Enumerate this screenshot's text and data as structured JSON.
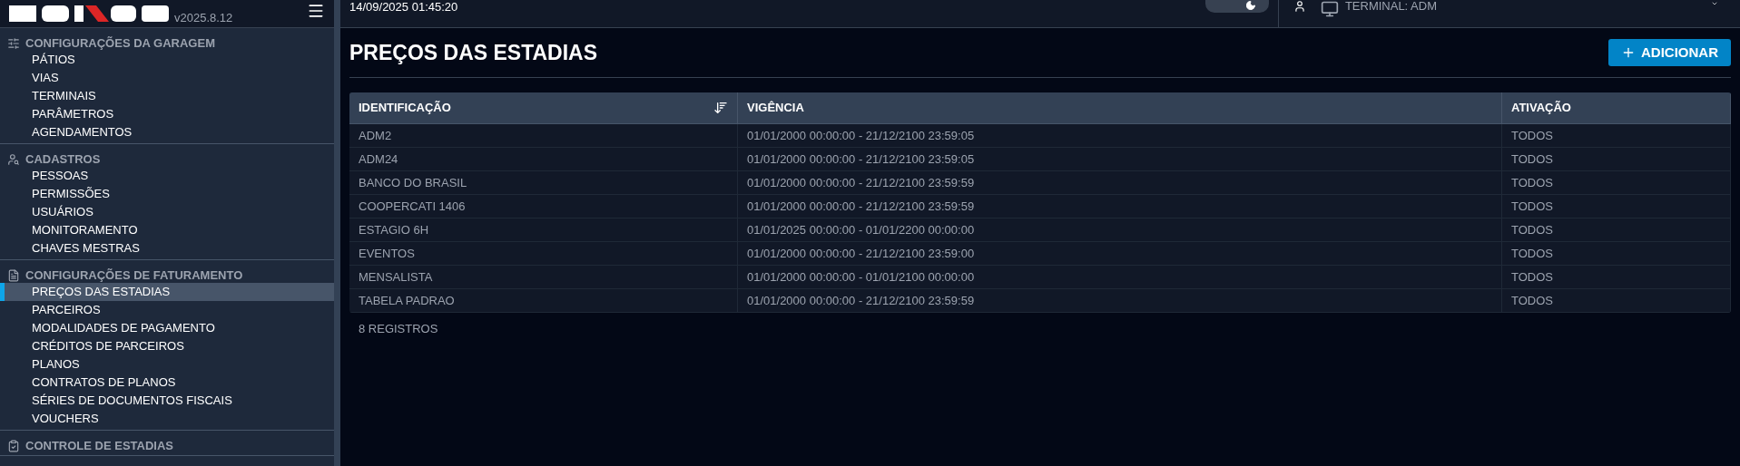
{
  "brand": {
    "version": "v2025.8.12"
  },
  "top_bar": {
    "datetime": "14/09/2025 01:45:20",
    "theme_dark": true,
    "terminal": "TERMINAL: ADM"
  },
  "sidebar": {
    "sections": [
      {
        "title": "CONFIGURAÇÕES DA GARAGEM",
        "items": [
          {
            "label": "PÁTIOS",
            "selected": false
          },
          {
            "label": "VIAS",
            "selected": false
          },
          {
            "label": "TERMINAIS",
            "selected": false
          },
          {
            "label": "PARÂMETROS",
            "selected": false
          },
          {
            "label": "AGENDAMENTOS",
            "selected": false
          }
        ]
      },
      {
        "title": "CADASTROS",
        "items": [
          {
            "label": "PESSOAS",
            "selected": false
          },
          {
            "label": "PERMISSÕES",
            "selected": false
          },
          {
            "label": "USUÁRIOS",
            "selected": false
          },
          {
            "label": "MONITORAMENTO",
            "selected": false
          },
          {
            "label": "CHAVES MESTRAS",
            "selected": false
          }
        ]
      },
      {
        "title": "CONFIGURAÇÕES DE FATURAMENTO",
        "items": [
          {
            "label": "PREÇOS DAS ESTADIAS",
            "selected": true
          },
          {
            "label": "PARCEIROS",
            "selected": false
          },
          {
            "label": "MODALIDADES DE PAGAMENTO",
            "selected": false
          },
          {
            "label": "CRÉDITOS DE PARCEIROS",
            "selected": false
          },
          {
            "label": "PLANOS",
            "selected": false
          },
          {
            "label": "CONTRATOS DE PLANOS",
            "selected": false
          },
          {
            "label": "SÉRIES DE DOCUMENTOS FISCAIS",
            "selected": false
          },
          {
            "label": "VOUCHERS",
            "selected": false
          }
        ]
      },
      {
        "title": "CONTROLE DE ESTADIAS"
      }
    ]
  },
  "page": {
    "title": "PREÇOS DAS ESTADIAS",
    "add_button": "ADICIONAR",
    "table": {
      "columns": [
        {
          "label": "IDENTIFICAÇÃO",
          "sortable": true
        },
        {
          "label": "VIGÊNCIA",
          "sortable": false
        },
        {
          "label": "ATIVAÇÃO",
          "sortable": false
        }
      ],
      "rows": [
        [
          "ADM2",
          "01/01/2000 00:00:00 - 21/12/2100 23:59:05",
          "TODOS"
        ],
        [
          "ADM24",
          "01/01/2000 00:00:00 - 21/12/2100 23:59:05",
          "TODOS"
        ],
        [
          "BANCO DO BRASIL",
          "01/01/2000 00:00:00 - 21/12/2100 23:59:59",
          "TODOS"
        ],
        [
          "COOPERCATI 1406",
          "01/01/2000 00:00:00 - 21/12/2100 23:59:59",
          "TODOS"
        ],
        [
          "ESTAGIO 6H",
          "01/01/2025 00:00:00 - 01/01/2200 00:00:00",
          "TODOS"
        ],
        [
          "EVENTOS",
          "01/01/2000 00:00:00 - 21/12/2100 23:59:00",
          "TODOS"
        ],
        [
          "MENSALISTA",
          "01/01/2000 00:00:00 - 01/01/2100 00:00:00",
          "TODOS"
        ],
        [
          "TABELA PADRAO",
          "01/01/2000 00:00:00 - 21/12/2100 23:59:59",
          "TODOS"
        ]
      ]
    },
    "record_count": "8 REGISTROS"
  }
}
